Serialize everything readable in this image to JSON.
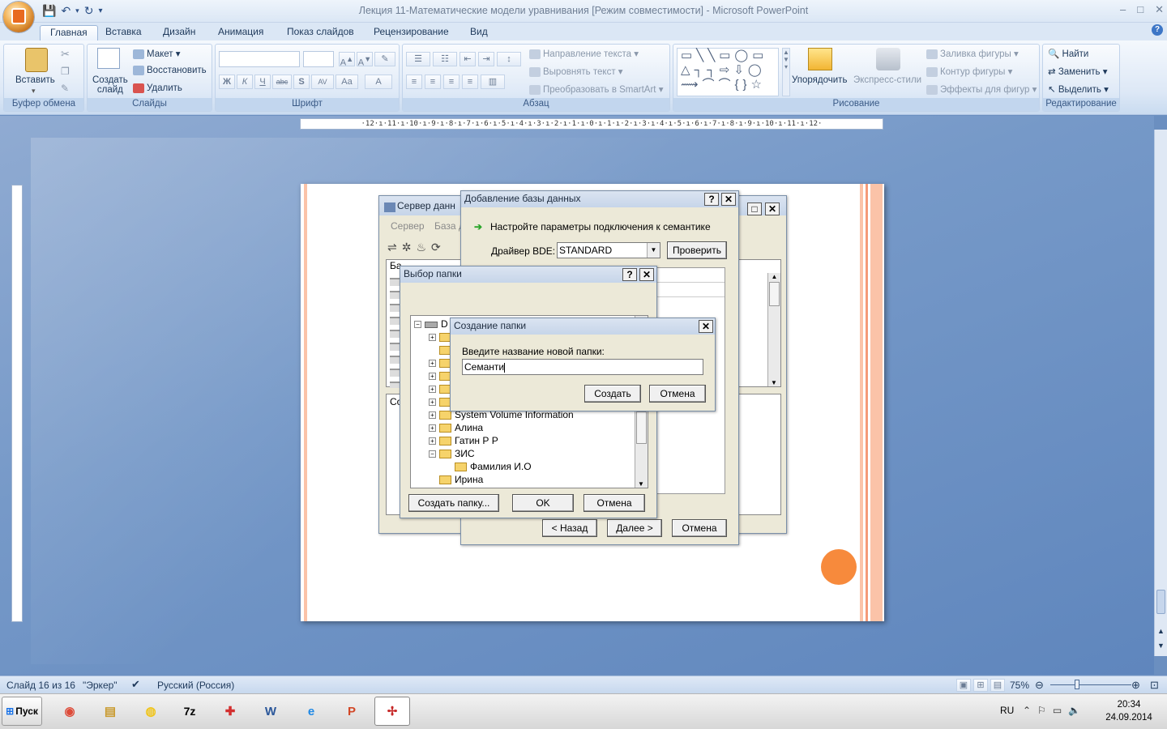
{
  "window": {
    "title": "Лекция 11-Математические модели уравнивания [Режим совместимости] - Microsoft PowerPoint",
    "controls": [
      "–",
      "□",
      "✕"
    ]
  },
  "ribbon_tabs": [
    "Главная",
    "Вставка",
    "Дизайн",
    "Анимация",
    "Показ слайдов",
    "Рецензирование",
    "Вид"
  ],
  "ribbon": {
    "clipboard": {
      "paste": "Вставить",
      "label": "Буфер обмена"
    },
    "slides": {
      "create": "Создать",
      "create2": "слайд",
      "layout": "Макет",
      "reset": "Восстановить",
      "delete": "Удалить",
      "label": "Слайды"
    },
    "font": {
      "label": "Шрифт",
      "buttons": [
        "Ж",
        "К",
        "Ч",
        "abc",
        "S",
        "AV",
        "Aa",
        "A"
      ]
    },
    "paragraph": {
      "text_direction": "Направление текста",
      "align_text": "Выровнять текст",
      "smartart": "Преобразовать в SmartArt",
      "label": "Абзац"
    },
    "drawing": {
      "arrange": "Упорядочить",
      "quick_styles": "Экспресс-стили",
      "fill": "Заливка фигуры",
      "outline": "Контур фигуры",
      "effects": "Эффекты для фигур",
      "label": "Рисование"
    },
    "editing": {
      "find": "Найти",
      "replace": "Заменить",
      "select": "Выделить",
      "label": "Редактирование"
    }
  },
  "ruler_h": "·12·ı·11·ı·10·ı·9·ı·8·ı·7·ı·6·ı·5·ı·4·ı·3·ı·2·ı·1·ı·0·ı·1·ı·2·ı·3·ı·4·ı·5·ı·6·ı·7·ı·8·ı·9·ı·10·ı·11·ı·12·",
  "server_window": {
    "title": "Сервер данн",
    "menu": [
      "Сервер",
      "База д"
    ],
    "col1": "Ба",
    "col2": "Со"
  },
  "add_db_dialog": {
    "title": "Добавление базы данных",
    "instruction": "Настройте параметры подключения к семантике",
    "driver_label": "Драйвер BDE:",
    "driver_value": "STANDARD",
    "check": "Проверить",
    "back": "< Назад",
    "next": "Далее >",
    "cancel": "Отмена"
  },
  "folder_dialog": {
    "title": "Выбор папки",
    "drive": "D",
    "tree": [
      "System Volume Information",
      "Алина",
      "Гатин Р Р",
      "ЗИС",
      "Фамилия И.О",
      "Ирина"
    ],
    "create_folder": "Создать папку...",
    "ok": "OK",
    "cancel": "Отмена"
  },
  "new_folder_dialog": {
    "title": "Создание папки",
    "prompt": "Введите название новой папки:",
    "value": "Семанти",
    "create": "Создать",
    "cancel": "Отмена"
  },
  "statusbar": {
    "slide": "Слайд 16 из 16",
    "theme": "\"Эркер\"",
    "language": "Русский (Россия)",
    "zoom": "75%"
  },
  "taskbar": {
    "start": "Пуск",
    "lang": "RU",
    "time": "20:34",
    "date": "24.09.2014"
  },
  "colors": {
    "accent_orange": "#f78a3c",
    "stripe": "#fbc3a8",
    "stripe_line": "#f59a78"
  }
}
